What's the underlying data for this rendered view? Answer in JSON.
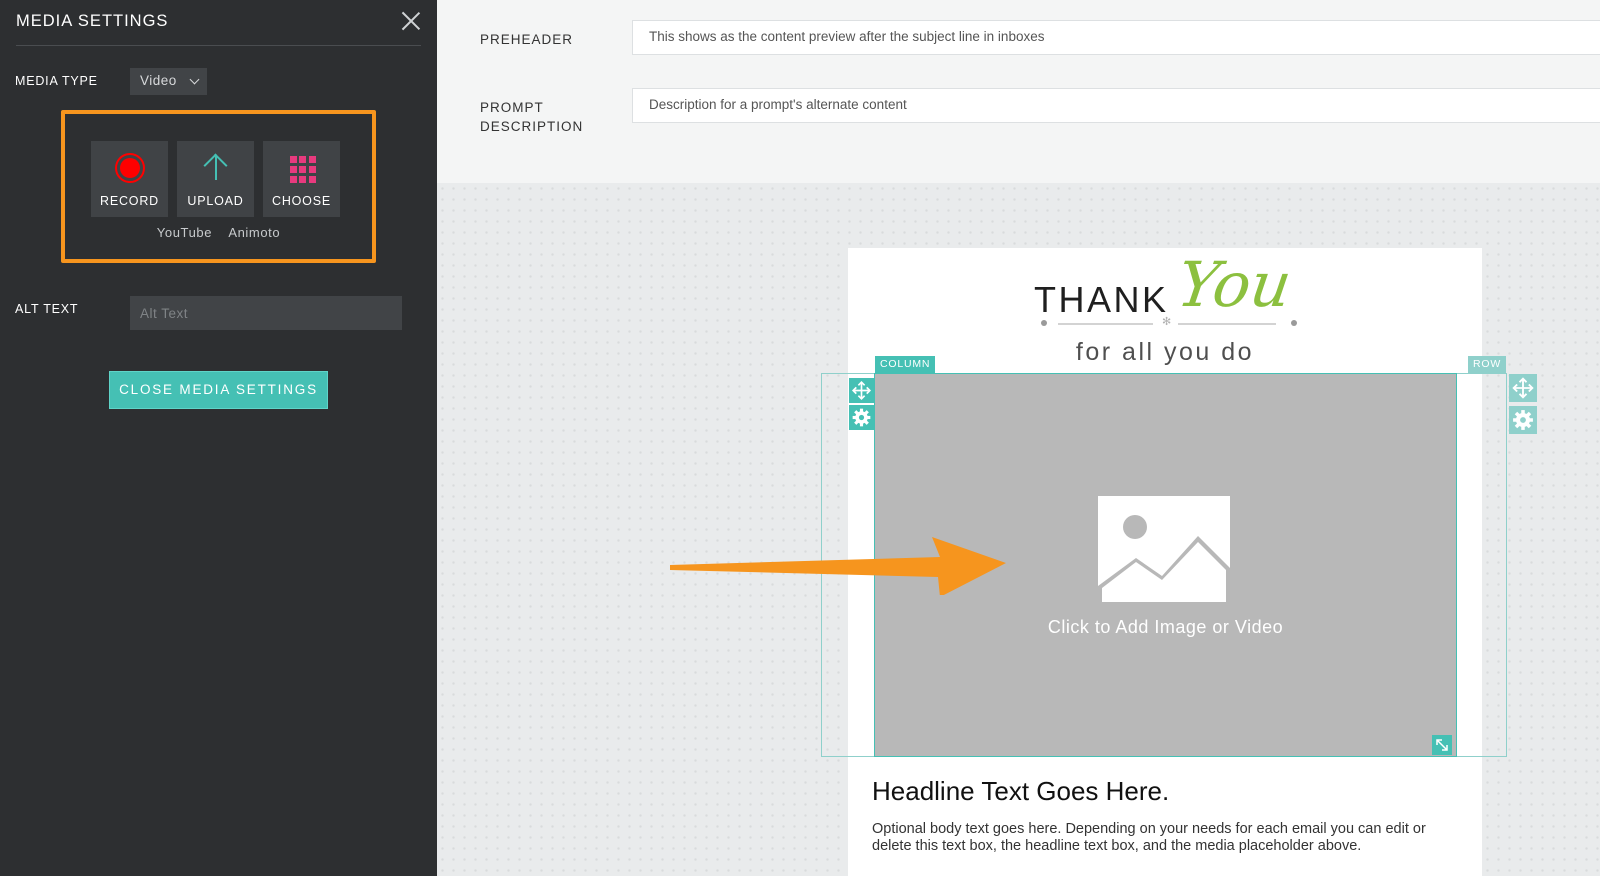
{
  "sidebar": {
    "title": "MEDIA SETTINGS",
    "media_type_label": "MEDIA TYPE",
    "media_type_value": "Video",
    "buttons": {
      "record": "RECORD",
      "upload": "UPLOAD",
      "choose": "CHOOSE"
    },
    "links": {
      "youtube": "YouTube",
      "animoto": "Animoto"
    },
    "alt_text_label": "ALT TEXT",
    "alt_text_placeholder": "Alt Text",
    "close_button": "CLOSE MEDIA SETTINGS",
    "icons": [
      "close-icon",
      "chevron-down-icon",
      "record-icon",
      "upload-arrow-icon",
      "grid-icon"
    ]
  },
  "header": {
    "preheader_label": "PREHEADER",
    "preheader_value": "This shows as the content preview after the subject line in inboxes",
    "prompt_label_line1": "PROMPT",
    "prompt_label_line2": "DESCRIPTION",
    "prompt_value": "Description for a prompt's alternate content"
  },
  "email": {
    "banner_thank": "THANK",
    "banner_you": "You",
    "banner_sub": "for all you do",
    "column_tag": "COLUMN",
    "row_tag": "ROW",
    "placeholder_cta": "Click to Add Image or Video",
    "headline": "Headline Text Goes Here.",
    "body": "Optional body text goes here. Depending on your needs for each email you can edit or delete this text box, the headline text box, and the media placeholder above."
  },
  "colors": {
    "sidebar_bg": "#2d2f31",
    "accent_teal": "#45c0b4",
    "highlight_orange": "#f6951e",
    "record_red": "#ff0000",
    "choose_pink": "#e83a7e",
    "banner_green": "#8cc03f"
  }
}
